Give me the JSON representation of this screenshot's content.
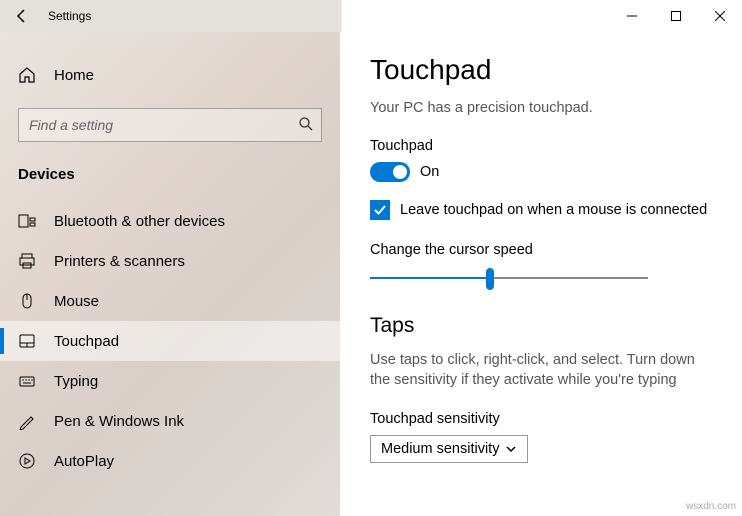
{
  "titlebar": {
    "app_title": "Settings"
  },
  "sidebar": {
    "home_label": "Home",
    "search_placeholder": "Find a setting",
    "section_label": "Devices",
    "items": [
      {
        "label": "Bluetooth & other devices"
      },
      {
        "label": "Printers & scanners"
      },
      {
        "label": "Mouse"
      },
      {
        "label": "Touchpad"
      },
      {
        "label": "Typing"
      },
      {
        "label": "Pen & Windows Ink"
      },
      {
        "label": "AutoPlay"
      }
    ]
  },
  "content": {
    "page_title": "Touchpad",
    "precision_text": "Your PC has a precision touchpad.",
    "touchpad_label": "Touchpad",
    "toggle_state": "On",
    "checkbox_label": "Leave touchpad on when a mouse is connected",
    "cursor_speed_label": "Change the cursor speed",
    "taps_header": "Taps",
    "taps_desc": "Use taps to click, right-click, and select. Turn down the sensitivity if they activate while you're typing",
    "sensitivity_label": "Touchpad sensitivity",
    "sensitivity_value": "Medium sensitivity"
  },
  "watermark": "wsxdn.com"
}
